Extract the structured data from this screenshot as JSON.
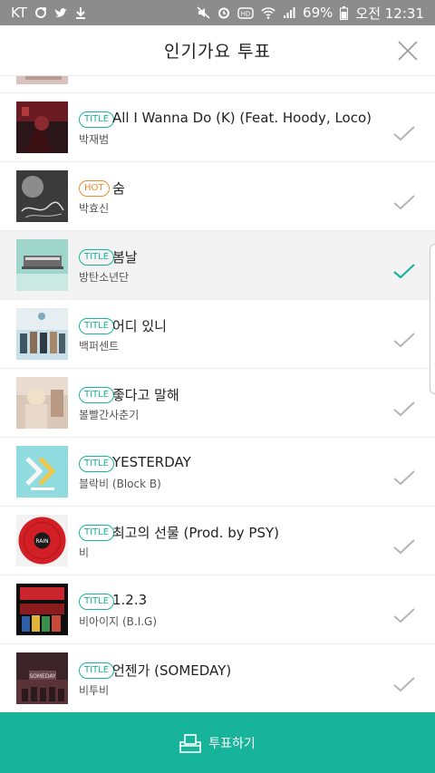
{
  "status_bar": {
    "carrier": "KT",
    "battery": "69%",
    "time": "오전 12:31",
    "icons": [
      "sync-icon",
      "twitter-icon",
      "download-icon",
      "mute-icon",
      "alarm-icon",
      "hd-icon",
      "wifi-icon",
      "signal-icon",
      "battery-icon"
    ]
  },
  "header": {
    "title": "인기가요 투표",
    "close_icon": "close-icon"
  },
  "songs": [
    {
      "badge": "",
      "title": "",
      "artist": "",
      "selected": false,
      "art": "partial-pink"
    },
    {
      "badge": "TITLE",
      "title": "All I Wanna Do (K) (Feat. Hoody, Loco)",
      "artist": "박재범",
      "selected": false,
      "art": "red-dark"
    },
    {
      "badge": "HOT",
      "title": "숨",
      "artist": "박효신",
      "selected": false,
      "art": "bw-script"
    },
    {
      "badge": "TITLE",
      "title": "봄날",
      "artist": "방탄소년단",
      "selected": true,
      "art": "teal-platform"
    },
    {
      "badge": "TITLE",
      "title": "어디 있니",
      "artist": "백퍼센트",
      "selected": false,
      "art": "group-blue"
    },
    {
      "badge": "TITLE",
      "title": "좋다고 말해",
      "artist": "볼빨간사춘기",
      "selected": false,
      "art": "pastel"
    },
    {
      "badge": "TITLE",
      "title": "YESTERDAY",
      "artist": "블락비 (Block B)",
      "selected": false,
      "art": "cyan-logo"
    },
    {
      "badge": "TITLE",
      "title": "최고의 선물 (Prod. by PSY)",
      "artist": "비",
      "selected": false,
      "art": "red-vinyl"
    },
    {
      "badge": "TITLE",
      "title": "1.2.3",
      "artist": "비아이지 (B.I.G)",
      "selected": false,
      "art": "red-group"
    },
    {
      "badge": "TITLE",
      "title": "언젠가 (SOMEDAY)",
      "artist": "비투비",
      "selected": false,
      "art": "dark-someday"
    }
  ],
  "album_art_text": {
    "rain": "RAIN",
    "someday": "SOMEDAY"
  },
  "vote_button": {
    "label": "투표하기",
    "icon": "ballot-box-icon"
  },
  "colors": {
    "accent": "#17b39a",
    "hot": "#f08a2c",
    "status_bar": "#8c8c8c"
  }
}
